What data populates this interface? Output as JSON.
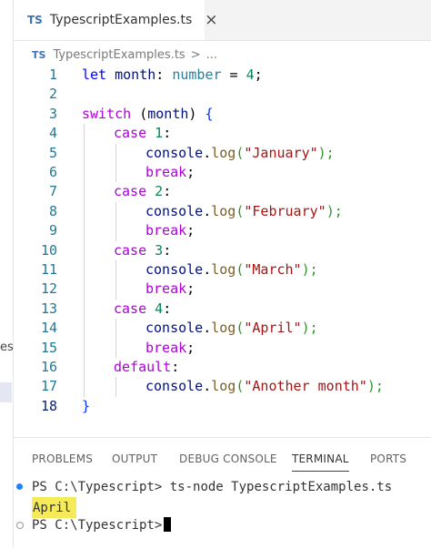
{
  "tab": {
    "badge": "TS",
    "filename": "TypescriptExamples.ts",
    "close_icon": "×"
  },
  "breadcrumb": {
    "badge": "TS",
    "file": "TypescriptExamples.ts",
    "separator": ">",
    "more": "..."
  },
  "left_fragment": "es",
  "editor": {
    "active_line": 18,
    "line_numbers": [
      "1",
      "2",
      "3",
      "4",
      "5",
      "6",
      "7",
      "8",
      "9",
      "10",
      "11",
      "12",
      "13",
      "14",
      "15",
      "16",
      "17",
      "18"
    ],
    "code": {
      "l1": {
        "kw": "let",
        "var": "month",
        "colon": ": ",
        "type": "number",
        "eq": " = ",
        "num": "4",
        "semi": ";"
      },
      "l3": {
        "kw": "switch",
        "open": " (",
        "var": "month",
        "close": ") ",
        "brace": "{"
      },
      "case_kw": "case",
      "cases": [
        {
          "num": "1",
          "colon": ":",
          "month": "\"January\""
        },
        {
          "num": "2",
          "colon": ":",
          "month": "\"February\""
        },
        {
          "num": "3",
          "colon": ":",
          "month": "\"March\""
        },
        {
          "num": "4",
          "colon": ":",
          "month": "\"April\""
        }
      ],
      "console": "console",
      "dot": ".",
      "log": "log",
      "lparen": "(",
      "rparen": ");",
      "break_kw": "break",
      "semi": ";",
      "default_kw": "default",
      "default_colon": ":",
      "default_str": "\"Another month\"",
      "closing_brace": "}"
    }
  },
  "panel": {
    "tabs": [
      "PROBLEMS",
      "OUTPUT",
      "DEBUG CONSOLE",
      "TERMINAL",
      "PORTS"
    ],
    "active_tab": "TERMINAL"
  },
  "terminal": {
    "prompt1": "PS C:\\Typescript>",
    "command": " ts-node TypescriptExamples.ts",
    "output": "April",
    "prompt2": "PS C:\\Typescript>"
  },
  "colors": {
    "keyword": "#0000ff",
    "control": "#af00db",
    "type": "#267f99",
    "number": "#098658",
    "string": "#a31515",
    "function": "#795e26",
    "variable": "#001080",
    "highlight": "#f5ea57"
  }
}
